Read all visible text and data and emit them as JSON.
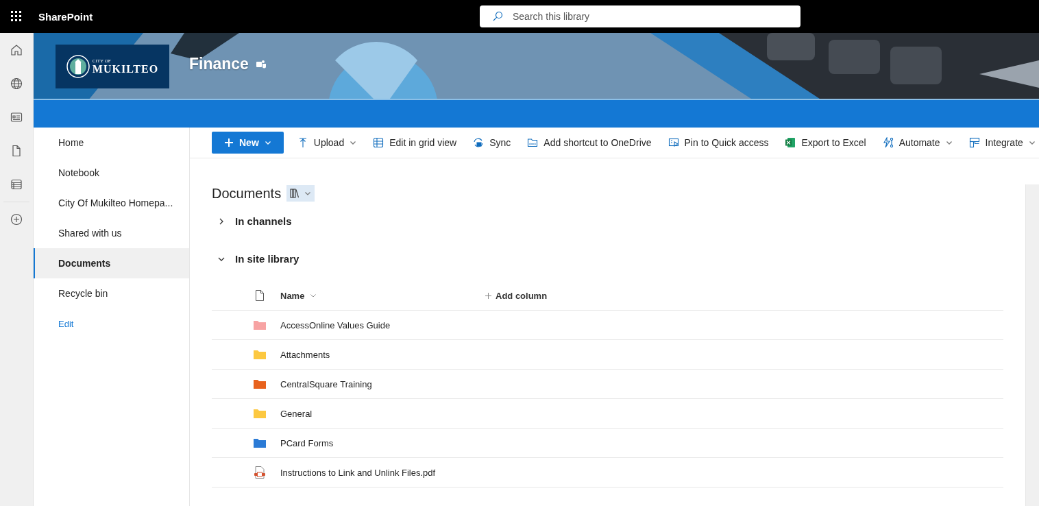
{
  "app_bar": {
    "title": "SharePoint",
    "search": {
      "placeholder": "Search this library"
    }
  },
  "site": {
    "logo": {
      "small": "CITY OF",
      "large": "MUKILTEO"
    },
    "title": "Finance"
  },
  "nav": [
    {
      "label": "Home",
      "selected": false
    },
    {
      "label": "Notebook",
      "selected": false
    },
    {
      "label": "City Of Mukilteo Homepa...",
      "selected": false
    },
    {
      "label": "Shared with us",
      "selected": false
    },
    {
      "label": "Documents",
      "selected": true
    },
    {
      "label": "Recycle bin",
      "selected": false
    }
  ],
  "nav_edit": "Edit",
  "commands": [
    {
      "label": "New",
      "kind": "primary",
      "has_menu": true
    },
    {
      "label": "Upload",
      "kind": "plain",
      "has_menu": true
    },
    {
      "label": "Edit in grid view",
      "kind": "plain",
      "has_menu": false
    },
    {
      "label": "Sync",
      "kind": "plain",
      "has_menu": false
    },
    {
      "label": "Add shortcut to OneDrive",
      "kind": "plain",
      "has_menu": false
    },
    {
      "label": "Pin to Quick access",
      "kind": "plain",
      "has_menu": false
    },
    {
      "label": "Export to Excel",
      "kind": "plain",
      "has_menu": false
    },
    {
      "label": "Automate",
      "kind": "plain",
      "has_menu": true
    },
    {
      "label": "Integrate",
      "kind": "plain",
      "has_menu": true
    }
  ],
  "library": {
    "title": "Documents",
    "sections": [
      {
        "label": "In channels",
        "expanded": false
      },
      {
        "label": "In site library",
        "expanded": true
      }
    ],
    "columns": {
      "name": "Name",
      "add": "Add column"
    },
    "rows": [
      {
        "name": "AccessOnline Values Guide",
        "kind": "folder",
        "color": "#f7a3a3"
      },
      {
        "name": "Attachments",
        "kind": "folder",
        "color": "#fcc840"
      },
      {
        "name": "CentralSquare Training",
        "kind": "folder",
        "color": "#e8621d"
      },
      {
        "name": "General",
        "kind": "folder",
        "color": "#fcc840"
      },
      {
        "name": "PCard Forms",
        "kind": "folder",
        "color": "#2b7bd6"
      },
      {
        "name": "Instructions to Link and Unlink Files.pdf",
        "kind": "pdf"
      }
    ]
  }
}
